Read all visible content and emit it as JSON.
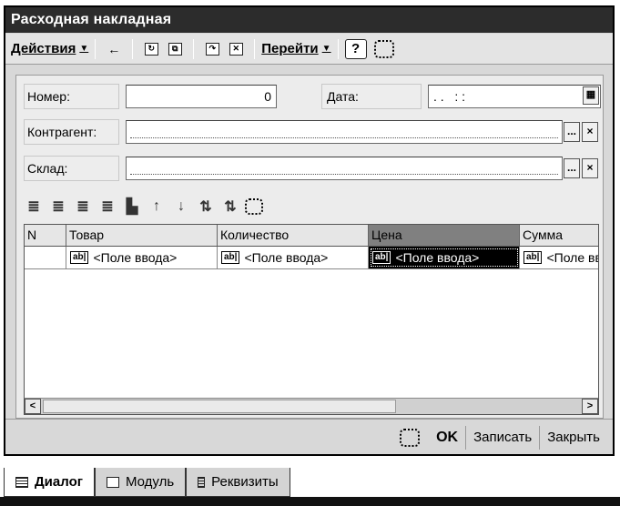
{
  "window": {
    "title": "Расходная накладная"
  },
  "menubar": {
    "actions_label": "Действия",
    "goto_label": "Перейти",
    "help_label": "?"
  },
  "form": {
    "number_label": "Номер:",
    "number_value": "0",
    "date_label": "Дата:",
    "date_value": ". .   : :",
    "counterparty_label": "Контрагент:",
    "counterparty_value": "",
    "warehouse_label": "Склад:",
    "warehouse_value": "",
    "ellipsis": "...",
    "clear": "×"
  },
  "table": {
    "columns": [
      "N",
      "Товар",
      "Количество",
      "Цена",
      "Сумма"
    ],
    "active_column": "Цена",
    "row": [
      "",
      "<Поле ввода>",
      "<Поле ввода>",
      "<Поле ввода>",
      "<Поле ввода>"
    ],
    "field_icon_text": "ab|",
    "scroll_left": "<",
    "scroll_right": ">"
  },
  "bottombar": {
    "ok_label": "OK",
    "save_label": "Записать",
    "close_label": "Закрыть"
  },
  "tabs": [
    {
      "label": "Диалог",
      "active": true
    },
    {
      "label": "Модуль",
      "active": false
    },
    {
      "label": "Реквизиты",
      "active": false
    }
  ]
}
